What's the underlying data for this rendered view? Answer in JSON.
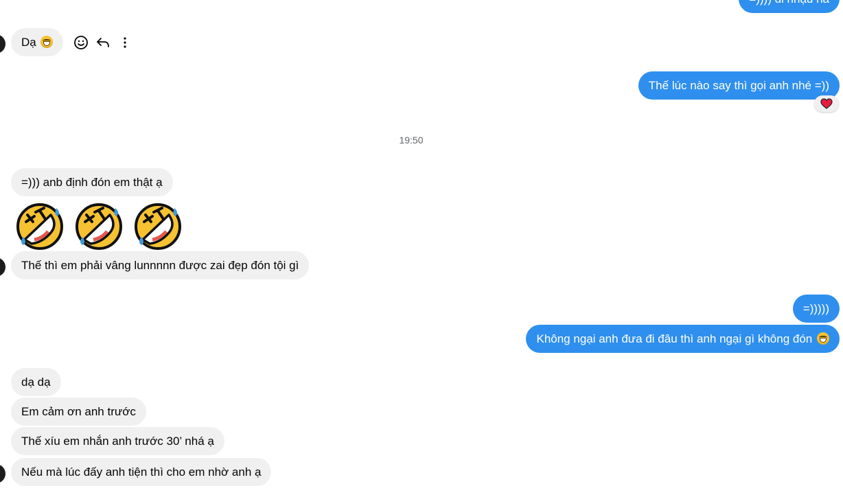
{
  "messages": {
    "top_partial": "=)))) đi nhậu hả",
    "m1": "Dạ",
    "m2": "Thế lúc nào say thì gọi anh nhé =))",
    "timestamp": "19:50",
    "m3": "=))) anb định đón em thật ạ",
    "m4": "Thế thì em phải vâng lunnnnn được zai đẹp đón tội gì",
    "m5": "=)))))",
    "m6": "Không ngại anh đưa đi đâu thì anh ngại gì không đón",
    "m7": "dạ dạ",
    "m8": "Em cảm ơn anh trước",
    "m9": "Thế xíu em nhắn anh trước 30’ nhá ạ",
    "m10": "Nếu mà lúc đấy anh tiện thì cho em nhờ anh ạ"
  },
  "icons": {
    "react": "smiley-icon",
    "reply": "reply-icon",
    "more": "more-vertical-icon",
    "reaction": "heart-icon",
    "big_emoji": "rolling-laughing-emoji"
  },
  "colors": {
    "outgoing": "#2f8fee",
    "incoming": "#f0f0f0",
    "heart": "#e41e3f"
  }
}
